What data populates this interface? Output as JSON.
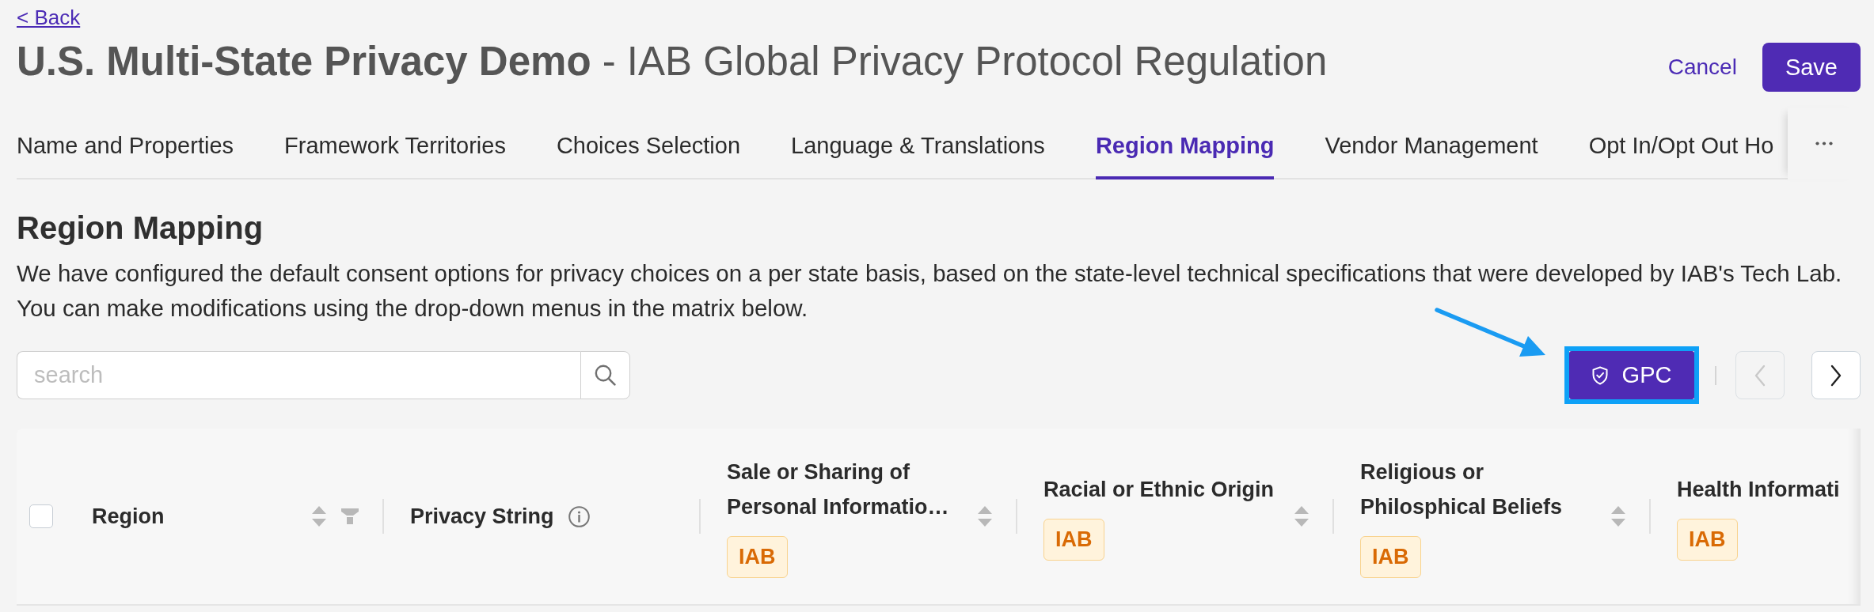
{
  "back_link": "< Back",
  "title": "**U.S. Multi-State Privacy Demo** - IAB Global Privacy Protocol Regulation",
  "actions": [
    {
      "label": "Cancel",
      "kind": "link"
    },
    {
      "label": "Save",
      "kind": "primary"
    }
  ],
  "tabs": [
    {
      "label": "Name and Properties",
      "selected": false
    },
    {
      "label": "Framework Territories",
      "selected": false
    },
    {
      "label": "Choices Selection",
      "selected": false
    },
    {
      "label": "Language & Translations",
      "selected": false
    },
    {
      "label": "Region Mapping",
      "selected": true
    },
    {
      "label": "Vendor Management",
      "selected": false
    },
    {
      "label": "Opt In/Opt Out Ho",
      "selected": false
    }
  ],
  "section": {
    "heading": "Region Mapping",
    "description": [
      "We have configured the default consent options for privacy choices on a per state basis, based on the state-level technical specifications that were developed by IAB's Tech Lab.",
      "You can make modifications using the drop-down menus in the matrix below."
    ]
  },
  "search": {
    "placeholder": "search"
  },
  "gpc_button": {
    "label": "GPC",
    "highlighted": true
  },
  "pager": [
    {
      "kind": "previous",
      "disabled": true
    },
    {
      "kind": "next",
      "disabled": false
    }
  ],
  "table": {
    "select_all": {
      "checked": false
    },
    "columns": [
      {
        "label": "Region",
        "sortable": true,
        "filterable": true,
        "info": false
      },
      {
        "label": "Privacy String",
        "sortable": false,
        "filterable": false,
        "info": true
      },
      {
        "label": "Sale or Sharing of Personal Informatio…",
        "badge": "IAB",
        "sortable": true,
        "filterable": false,
        "info": false
      },
      {
        "label": "Racial or Ethnic Origin",
        "badge": "IAB",
        "sortable": true,
        "filterable": false,
        "info": false
      },
      {
        "label": "Religious or Philosphical Beliefs",
        "badge": "IAB",
        "sortable": true,
        "filterable": false,
        "info": false
      },
      {
        "label": "Health Informati",
        "badge": "IAB",
        "sortable": false,
        "filterable": false,
        "info": false
      }
    ]
  }
}
